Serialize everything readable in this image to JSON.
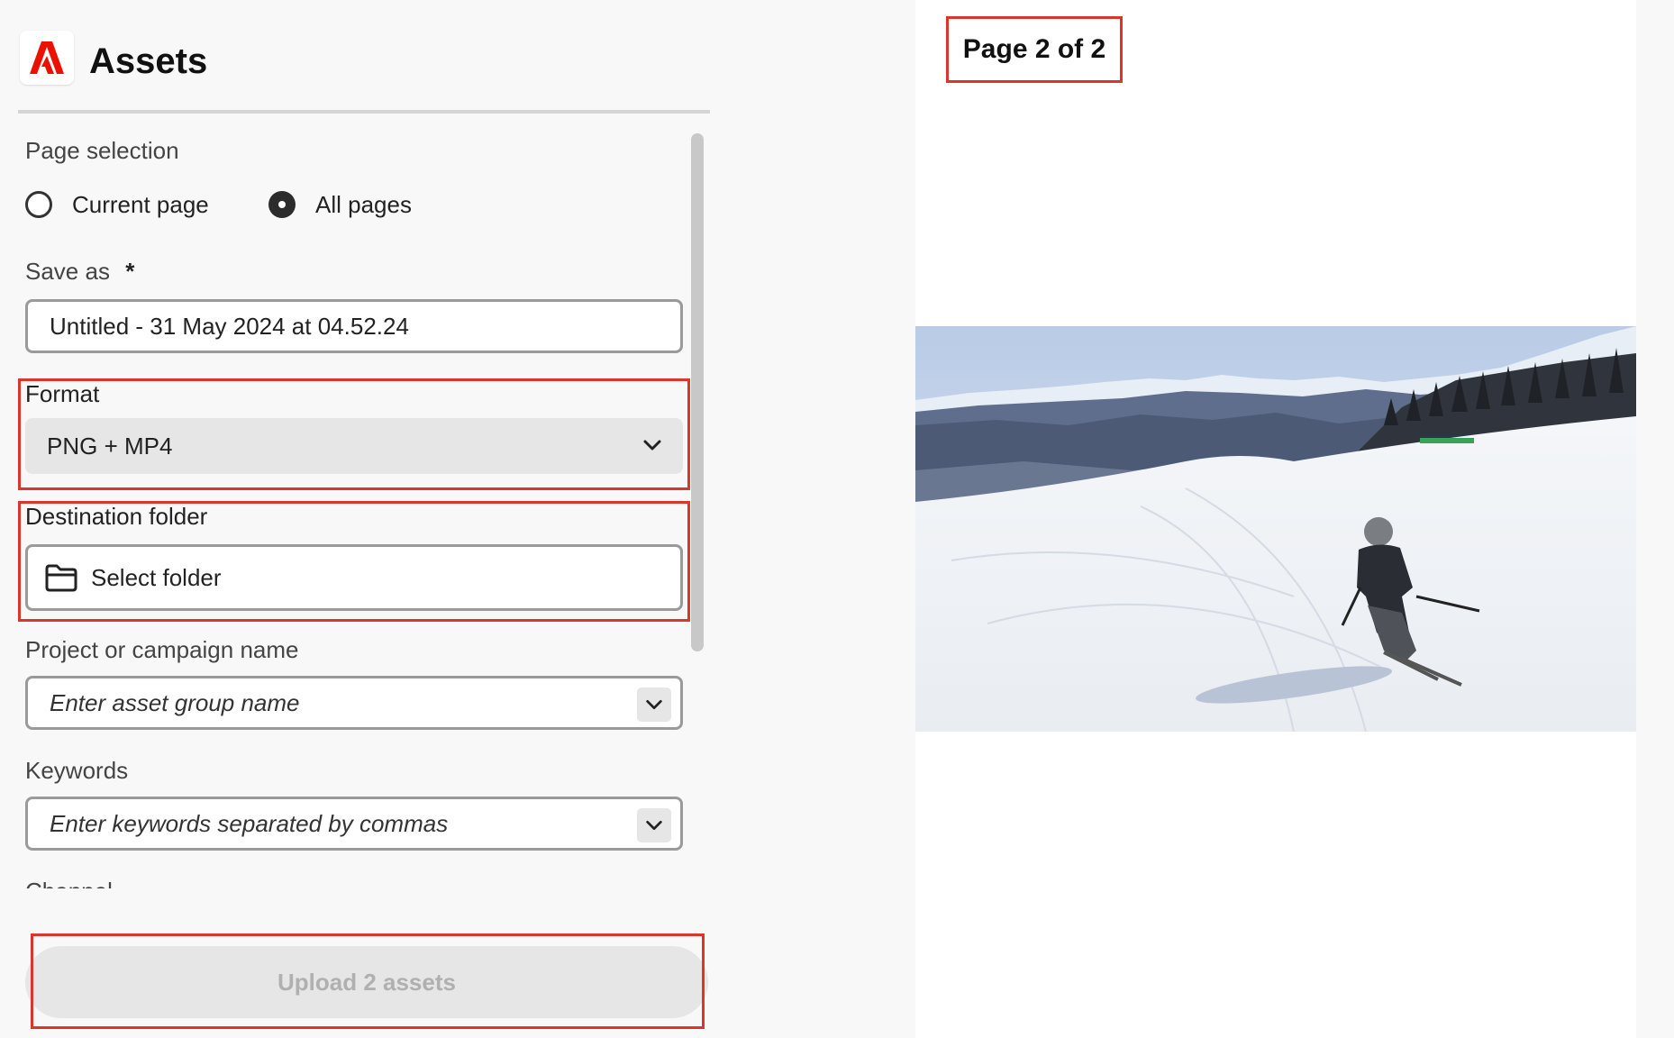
{
  "app": {
    "title": "Assets"
  },
  "form": {
    "page_selection": {
      "label": "Page selection",
      "options": [
        "Current page",
        "All pages"
      ],
      "selected": "All pages"
    },
    "save_as": {
      "label": "Save as",
      "required_mark": "*",
      "value": "Untitled - 31 May 2024 at 04.52.24"
    },
    "format": {
      "label": "Format",
      "value": "PNG + MP4"
    },
    "destination_folder": {
      "label": "Destination folder",
      "button_label": "Select folder"
    },
    "project_name": {
      "label": "Project or campaign name",
      "placeholder": "Enter asset group name"
    },
    "keywords": {
      "label": "Keywords",
      "placeholder": "Enter keywords separated by commas"
    },
    "next_section_label": "Channel"
  },
  "upload": {
    "label": "Upload 2 assets",
    "enabled": false
  },
  "preview": {
    "page_indicator": "Page 2 of 2"
  },
  "colors": {
    "highlight": "#d8382a",
    "brand": "#eb1000"
  }
}
